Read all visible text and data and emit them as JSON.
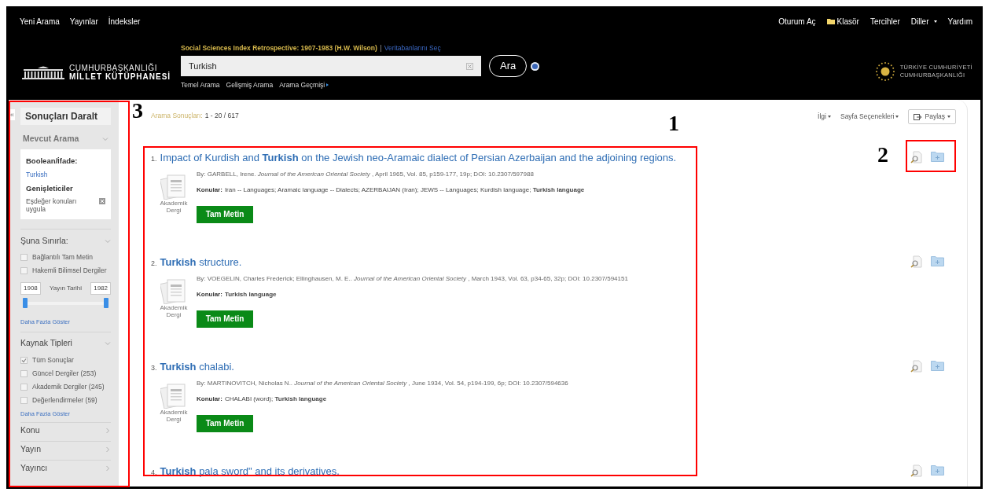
{
  "top_nav": {
    "left": [
      "Yeni Arama",
      "Yayınlar",
      "İndeksler"
    ],
    "right": [
      {
        "label": "Oturum Aç",
        "kind": "link"
      },
      {
        "label": "Klasör",
        "kind": "folder"
      },
      {
        "label": "Tercihler",
        "kind": "link"
      },
      {
        "label": "Diller",
        "kind": "dropdown"
      },
      {
        "label": "Yardım",
        "kind": "link"
      }
    ]
  },
  "logo": {
    "line1": "CUMHURBAŞKANLIĞI",
    "line2": "MİLLET KÜTÜPHANESİ"
  },
  "search": {
    "database": "Social Sciences Index Retrospective: 1907-1983 (H.W. Wilson)",
    "database_link": "Veritabanlarını Seç",
    "value": "Turkish",
    "button": "Ara",
    "links": [
      {
        "label": "Temel Arama",
        "kind": "link"
      },
      {
        "label": "Gelişmiş Arama",
        "kind": "link"
      },
      {
        "label": "Arama Geçmişi",
        "kind": "menu"
      }
    ]
  },
  "emblem": {
    "line1": "TÜRKİYE CUMHURİYETİ",
    "line2": "CUMHURBAŞKANLIĞI"
  },
  "sidebar": {
    "collapse": "«",
    "title": "Sonuçları Daralt",
    "current": {
      "title": "Mevcut Arama",
      "expanded": true,
      "boolean_label": "Boolean/İfade:",
      "boolean_value": "Turkish",
      "expanders_label": "Genişleticiler",
      "expander": "Eşdeğer konuları uygula"
    },
    "limit": {
      "title": "Şuna Sınırla:",
      "expanded": true,
      "options": [
        {
          "label": "Bağlantılı Tam Metin",
          "checked": false
        },
        {
          "label": "Hakemli Bilimsel Dergiler",
          "checked": false
        }
      ],
      "date_from": "1908",
      "date_label": "Yayın Tarihi",
      "date_to": "1982",
      "handles": [
        {
          "level": 0
        },
        {
          "level": 1
        }
      ],
      "more": "Daha Fazla Göster"
    },
    "source_types": {
      "title": "Kaynak Tipleri",
      "expanded": true,
      "options": [
        {
          "label": "Tüm Sonuçlar",
          "checked": true
        },
        {
          "label": "Güncel Dergiler (253)",
          "checked": false
        },
        {
          "label": "Akademik Dergiler (245)",
          "checked": false
        },
        {
          "label": "Değerlendirmeler (59)",
          "checked": false
        }
      ],
      "more": "Daha Fazla Göster"
    },
    "facets": [
      {
        "title": "Konu",
        "expanded": false
      },
      {
        "title": "Yayın",
        "expanded": false
      },
      {
        "title": "Yayıncı",
        "expanded": false
      }
    ]
  },
  "results_header": {
    "label": "Arama Sonuçları:",
    "range": "1 - 20 / 617",
    "sort": "İlgi",
    "page_options": "Sayfa Seçenekleri",
    "share": "Paylaş"
  },
  "results": [
    {
      "number": "1.",
      "title": "Impact of Kurdish and **Turkish** on the Jewish neo-Aramaic dialect of Persian Azerbaijan and the adjoining regions.",
      "byline": "By: GARBELL, Irene. *Journal of the American Oriental Society* , April 1965, Vol. 85, p159-177, 19p; DOI: 10.2307/597988",
      "subjects_label": "Konular:",
      "subjects": "Iran -- Languages; Aramaic language -- Dialects; AZERBAIJAN (Iran); JEWS -- Languages; Kurdish language; **Turkish language**",
      "type": "Akademik Dergi",
      "button": "Tam Metin"
    },
    {
      "number": "2.",
      "title": "**Turkish** structure.",
      "byline": "By: VOEGELIN, Charles Frederick; Ellinghausen, M. E.. *Journal of the American Oriental Society* , March 1943, Vol. 63, p34-65, 32p; DOI: 10.2307/594151",
      "subjects_label": "Konular:",
      "subjects": "**Turkish language**",
      "type": "Akademik Dergi",
      "button": "Tam Metin"
    },
    {
      "number": "3.",
      "title": "**Turkish** chalabi.",
      "byline": "By: MARTINOVITCH, Nicholas N.. *Journal of the American Oriental Society* , June 1934, Vol. 54, p194-199, 6p; DOI: 10.2307/594636",
      "subjects_label": "Konular:",
      "subjects": "CHALABI (word); **Turkish language**",
      "type": "Akademik Dergi",
      "button": "Tam Metin"
    },
    {
      "number": "4.",
      "title": "**Turkish** pala sword\" and its derivatives."
    }
  ],
  "annotations": [
    {
      "label": "3",
      "kind": "sidebar"
    },
    {
      "label": "1",
      "kind": "results"
    },
    {
      "label": "2",
      "kind": "actions"
    }
  ]
}
